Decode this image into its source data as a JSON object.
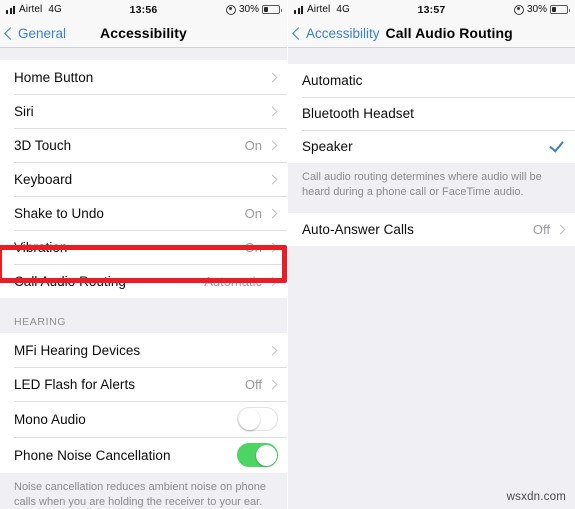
{
  "left_screen": {
    "status_bar": {
      "signal_icon": "signal-bars-icon",
      "carrier": "Airtel",
      "network": "4G",
      "time": "13:56",
      "location_icon": "location-services-icon",
      "battery_percent": "30%",
      "battery_icon": "battery-icon"
    },
    "nav": {
      "back_label": "General",
      "back_icon": "chevron-left-icon",
      "title": "Accessibility"
    },
    "rows": [
      {
        "label": "Home Button",
        "value": "",
        "accessory": "chevron"
      },
      {
        "label": "Siri",
        "value": "",
        "accessory": "chevron"
      },
      {
        "label": "3D Touch",
        "value": "On",
        "accessory": "chevron"
      },
      {
        "label": "Keyboard",
        "value": "",
        "accessory": "chevron"
      },
      {
        "label": "Shake to Undo",
        "value": "On",
        "accessory": "chevron"
      },
      {
        "label": "Vibration",
        "value": "On",
        "accessory": "chevron"
      },
      {
        "label": "Call Audio Routing",
        "value": "Automatic",
        "accessory": "chevron"
      }
    ],
    "section_header": "HEARING",
    "hearing_rows": [
      {
        "label": "MFi Hearing Devices",
        "value": "",
        "accessory": "chevron"
      },
      {
        "label": "LED Flash for Alerts",
        "value": "Off",
        "accessory": "chevron"
      },
      {
        "label": "Mono Audio",
        "value": "",
        "accessory": "switch-off"
      },
      {
        "label": "Phone Noise Cancellation",
        "value": "",
        "accessory": "switch-on"
      }
    ],
    "footnote": "Noise cancellation reduces ambient noise on phone calls when you are holding the receiver to your ear."
  },
  "right_screen": {
    "status_bar": {
      "signal_icon": "signal-bars-icon",
      "carrier": "Airtel",
      "network": "4G",
      "time": "13:57",
      "location_icon": "location-services-icon",
      "battery_percent": "30%",
      "battery_icon": "battery-icon"
    },
    "nav": {
      "back_label": "Accessibility",
      "back_icon": "chevron-left-icon",
      "title": "Call Audio Routing"
    },
    "options": [
      {
        "label": "Automatic",
        "selected": false
      },
      {
        "label": "Bluetooth Headset",
        "selected": false
      },
      {
        "label": "Speaker",
        "selected": true
      }
    ],
    "footnote": "Call audio routing determines where audio will be heard during a phone call or FaceTime audio.",
    "auto_answer": {
      "label": "Auto-Answer Calls",
      "value": "Off",
      "accessory": "chevron"
    }
  },
  "annotation": {
    "highlight_color": "#ed1c24",
    "highlight_target": "Call Audio Routing"
  },
  "watermark": "wsxdn.com",
  "colors": {
    "tint_blue": "#3b7fd4",
    "switch_green": "#4cd464",
    "checkmark_blue": "#3b7fc4",
    "group_bg": "#efeff4"
  }
}
